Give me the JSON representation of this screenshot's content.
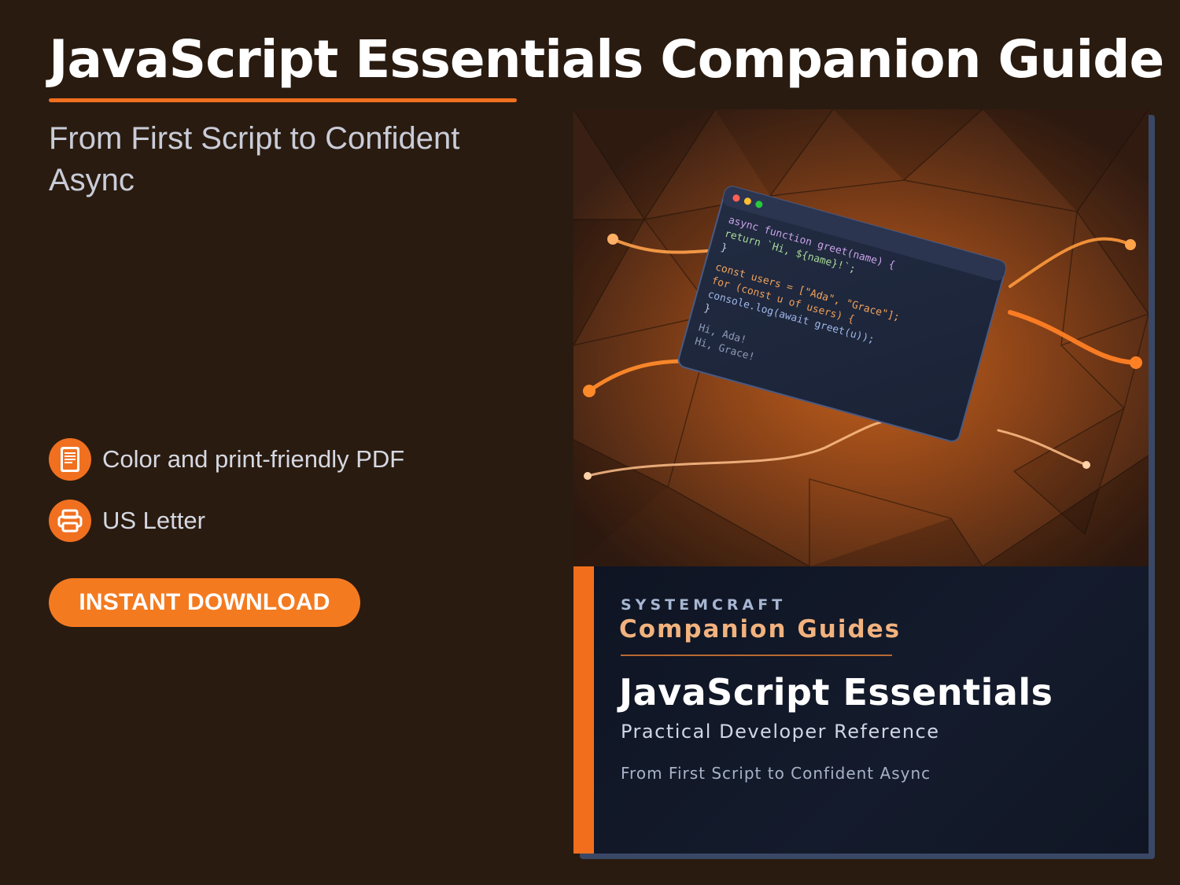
{
  "header": {
    "title": "JavaScript Essentials Companion Guide",
    "subtitle": "From First Script to Confident Async"
  },
  "features": [
    {
      "label": "Color and print-friendly PDF",
      "icon": "document-icon"
    },
    {
      "label": "US Letter",
      "icon": "printer-icon"
    }
  ],
  "cta": {
    "label": "INSTANT DOWNLOAD"
  },
  "cover": {
    "brand": "SYSTEMCRAFT",
    "series": "Companion Guides",
    "title": "JavaScript Essentials",
    "subtitle": "Practical Developer Reference",
    "tagline": "From First Script to Confident Async",
    "code_lines": [
      "async function greet(name) {",
      "  return `Hi, ${name}!`;",
      "}",
      "const users = [\"Ada\", \"Grace\"];",
      "for (const u of users) {",
      "  console.log(await greet(u));",
      "}",
      "Hi, Ada!",
      "Hi, Grace!"
    ]
  },
  "colors": {
    "background": "#2a1b10",
    "accent": "#f07020",
    "cover_dark": "#0f1420",
    "series_text": "#f2b27e"
  }
}
